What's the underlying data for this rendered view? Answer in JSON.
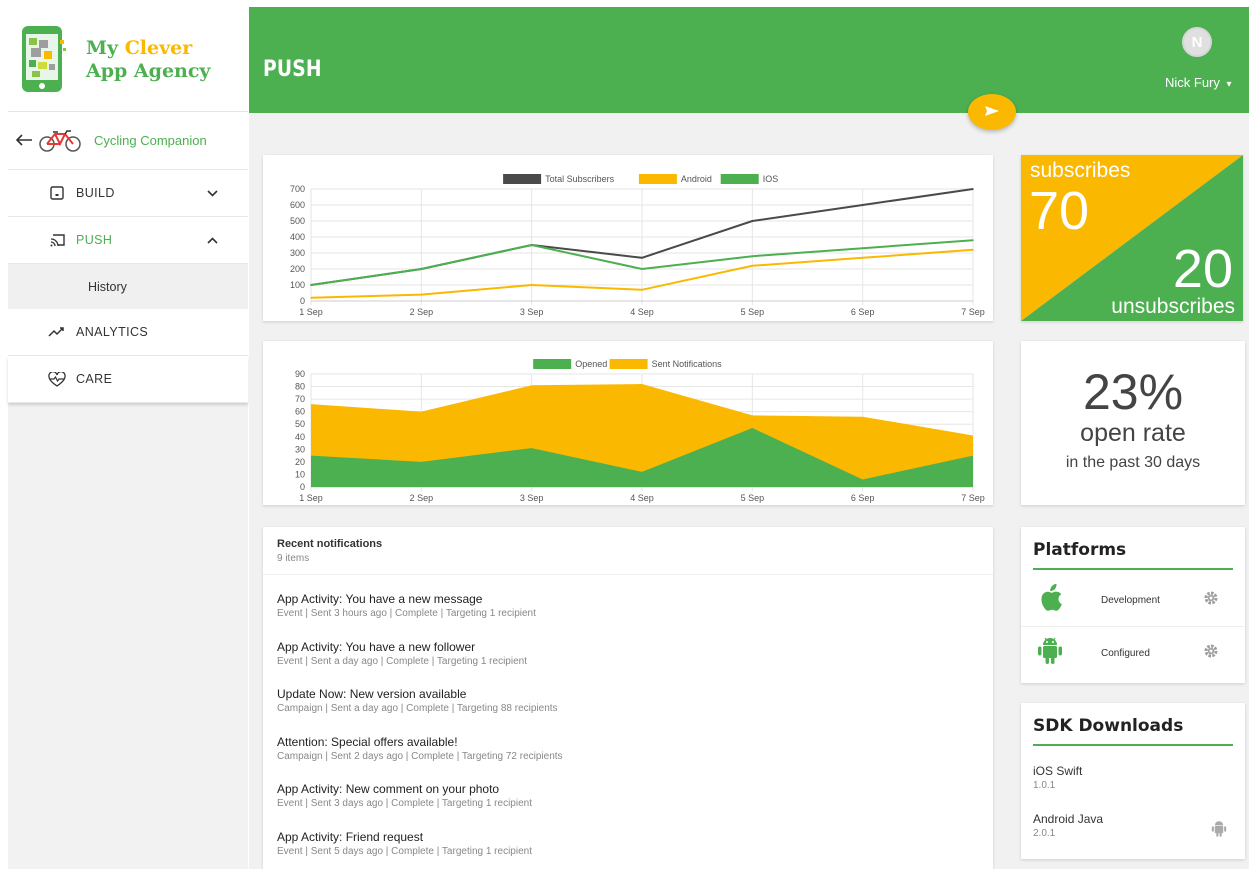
{
  "colors": {
    "green": "#4caf50",
    "yellow": "#fbb800",
    "dark_line": "#4a4a4a",
    "background": "#f1f1f1"
  },
  "brand": {
    "line1_a": "My ",
    "line1_b": "Clever",
    "line2": "App Agency",
    "icon": "phone-app-icon"
  },
  "sidebar": {
    "back_icon": "arrow-left-icon",
    "app_icon": "bicycle-icon",
    "app_name": "Cycling Companion",
    "items": [
      {
        "label": "BUILD",
        "icon": "build-box-icon",
        "chevron": "chevron-down-icon"
      },
      {
        "label": "PUSH",
        "icon": "cast-icon",
        "chevron": "chevron-up-icon",
        "active": true
      },
      {
        "label": "History",
        "sub": true
      },
      {
        "label": "ANALYTICS",
        "icon": "trend-line-icon"
      },
      {
        "label": "CARE",
        "icon": "heartbeat-icon"
      }
    ]
  },
  "header": {
    "title": "PUSH",
    "avatar_initial": "N",
    "user_name": "Nick Fury",
    "user_caret": "▾",
    "send_icon": "send-icon"
  },
  "chart_data": [
    {
      "type": "line",
      "categories": [
        "1 Sep",
        "2 Sep",
        "3 Sep",
        "4 Sep",
        "5 Sep",
        "6 Sep",
        "7 Sep"
      ],
      "series": [
        {
          "name": "Total Subscribers",
          "color": "#4a4a4a",
          "values": [
            100,
            200,
            350,
            270,
            500,
            600,
            700
          ]
        },
        {
          "name": "Android",
          "color": "#fbb800",
          "values": [
            20,
            40,
            100,
            70,
            220,
            270,
            320
          ]
        },
        {
          "name": "IOS",
          "color": "#4caf50",
          "values": [
            100,
            200,
            350,
            200,
            280,
            330,
            380
          ]
        }
      ],
      "yticks": [
        0,
        100,
        200,
        300,
        400,
        500,
        600,
        700
      ],
      "ylim": [
        0,
        700
      ],
      "grid": true,
      "legend": "top"
    },
    {
      "type": "area",
      "categories": [
        "1 Sep",
        "2 Sep",
        "3 Sep",
        "4 Sep",
        "5 Sep",
        "6 Sep",
        "7 Sep"
      ],
      "series": [
        {
          "name": "Opened",
          "color": "#4caf50",
          "values": [
            25,
            20,
            31,
            12,
            47,
            6,
            25
          ]
        },
        {
          "name": "Sent Notifications",
          "color": "#fbb800",
          "values": [
            66,
            60,
            81,
            82,
            57,
            56,
            41
          ]
        }
      ],
      "yticks": [
        0,
        10,
        20,
        30,
        40,
        50,
        60,
        70,
        80,
        90
      ],
      "ylim": [
        0,
        90
      ],
      "grid": true,
      "legend": "top"
    }
  ],
  "stats": {
    "subscribes_label": "subscribes",
    "subscribes_value": "70",
    "unsubscribes_value": "20",
    "unsubscribes_label": "unsubscribes",
    "open_rate_value": "23%",
    "open_rate_label": "open rate",
    "open_rate_period": "in the past 30 days"
  },
  "platforms": {
    "title": "Platforms",
    "items": [
      {
        "icon": "apple-icon",
        "status": "Development",
        "settings_icon": "gear-icon"
      },
      {
        "icon": "android-icon",
        "status": "Configured",
        "settings_icon": "gear-icon"
      }
    ]
  },
  "sdk": {
    "title": "SDK Downloads",
    "items": [
      {
        "name": "iOS Swift",
        "version": "1.0.1"
      },
      {
        "name": "Android Java",
        "version": "2.0.1",
        "icon": "android-icon"
      }
    ]
  },
  "notifications": {
    "title": "Recent notifications",
    "count": "9 items",
    "items": [
      {
        "title": "App Activity: You have a new message",
        "meta": "Event | Sent 3 hours ago | Complete | Targeting 1 recipient"
      },
      {
        "title": "App Activity: You have a new follower",
        "meta": "Event | Sent a day ago | Complete | Targeting 1 recipient"
      },
      {
        "title": "Update Now: New version available",
        "meta": "Campaign | Sent a day ago | Complete | Targeting 88 recipients"
      },
      {
        "title": "Attention: Special offers available!",
        "meta": "Campaign | Sent 2 days ago | Complete | Targeting 72 recipients"
      },
      {
        "title": "App Activity: New comment on your photo",
        "meta": "Event | Sent 3 days ago | Complete | Targeting 1 recipient"
      },
      {
        "title": "App Activity: Friend request",
        "meta": "Event | Sent 5 days ago | Complete | Targeting 1 recipient"
      }
    ]
  }
}
